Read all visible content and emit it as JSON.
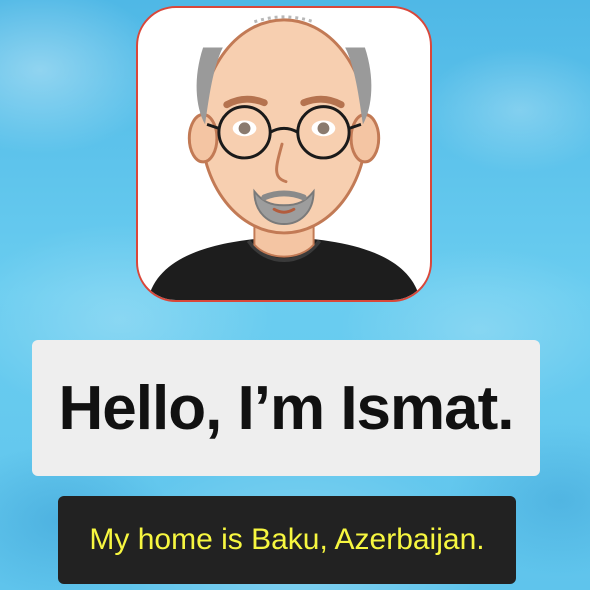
{
  "profile": {
    "avatar_icon": "cartoon-portrait-avatar",
    "greeting": "Hello, I’m Ismat.",
    "location": "My home is Baku, Azerbaijan."
  },
  "colors": {
    "background": "#5bc3ea",
    "greeting_box": "#eeeeee",
    "greeting_text": "#111111",
    "location_box": "#222222",
    "location_text": "#f7f740",
    "avatar_border": "#d9473a"
  }
}
